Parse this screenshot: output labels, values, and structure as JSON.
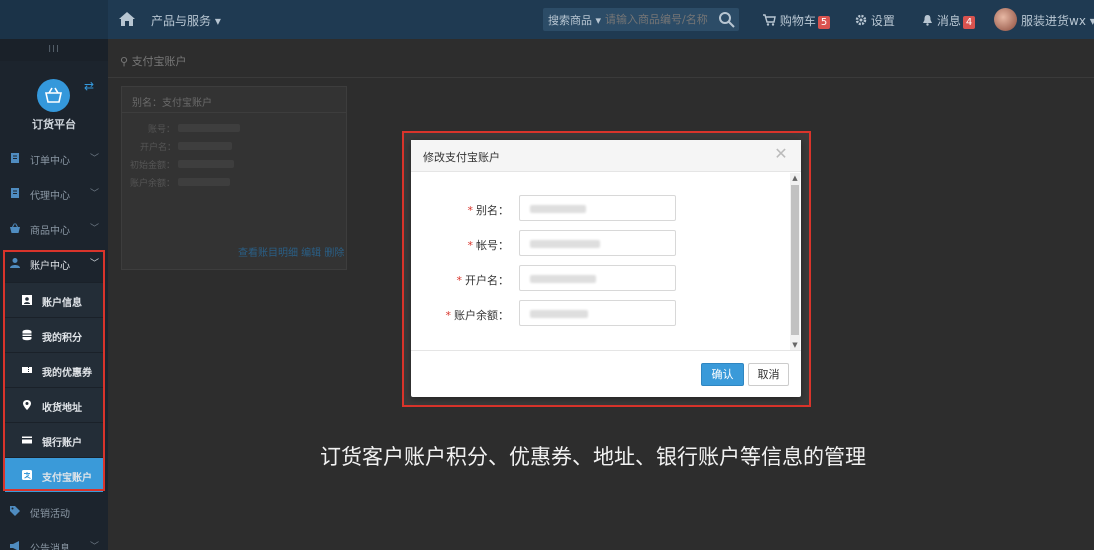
{
  "topbar": {
    "products_menu": "产品与服务 ▾",
    "search_category": "搜索商品 ▾",
    "search_placeholder": "请输入商品编号/名称",
    "cart_label": "购物车",
    "cart_count": "5",
    "settings_label": "设置",
    "messages_label": "消息",
    "messages_count": "4",
    "user_name": "服装进货wx ▾"
  },
  "sidebar": {
    "collapse_handle": "III",
    "brand_name": "订货平台",
    "items": [
      {
        "label": "订单中心"
      },
      {
        "label": "代理中心"
      },
      {
        "label": "商品中心"
      },
      {
        "label": "账户中心"
      }
    ],
    "sub_items": [
      {
        "label": "账户信息"
      },
      {
        "label": "我的积分"
      },
      {
        "label": "我的优惠券"
      },
      {
        "label": "收货地址"
      },
      {
        "label": "银行账户"
      },
      {
        "label": "支付宝账户"
      }
    ],
    "after_items": [
      {
        "label": "促销活动"
      },
      {
        "label": "公告消息"
      }
    ]
  },
  "content": {
    "breadcrumb": "支付宝账户",
    "card": {
      "title": "别名：支付宝账户",
      "rows": [
        "账号：",
        "开户名：",
        "初始金额：",
        "账户余额："
      ],
      "links": "查看账目明细  编辑  删除"
    }
  },
  "modal": {
    "title": "修改支付宝账户",
    "close_glyph": "✕",
    "fields": [
      {
        "label": "别名："
      },
      {
        "label": "帐号："
      },
      {
        "label": "开户名："
      },
      {
        "label": "账户余额："
      }
    ],
    "required_mark": "*",
    "confirm_label": "确认",
    "cancel_label": "取消"
  },
  "caption": "订货客户账户积分、优惠券、地址、银行账户等信息的管理",
  "colors": {
    "topbar": "#1f3a52",
    "sidebar": "#1c242d",
    "accent": "#3a9ad9",
    "highlight": "#d9342b"
  }
}
